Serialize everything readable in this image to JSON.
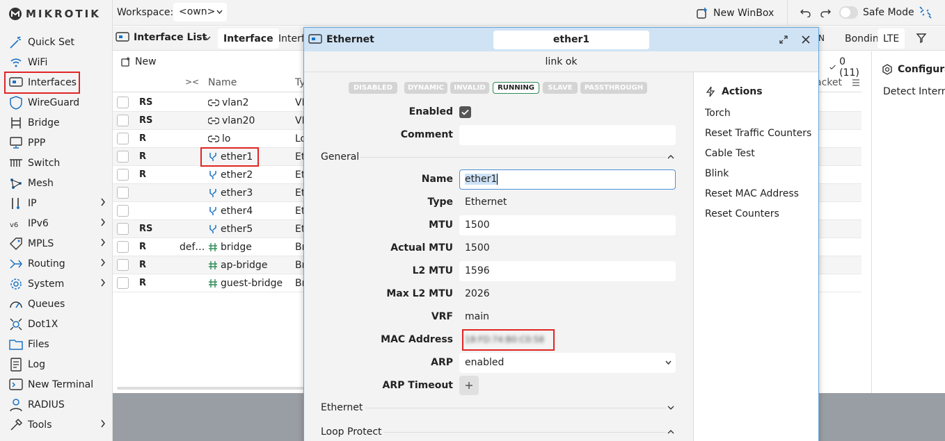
{
  "app": {
    "logo_text": "MIKROTIK"
  },
  "sidebar": {
    "items": [
      {
        "label": "Quick Set",
        "icon": "wand-icon",
        "chevron": false
      },
      {
        "label": "WiFi",
        "icon": "wifi-icon",
        "chevron": false
      },
      {
        "label": "Interfaces",
        "icon": "interfaces-icon",
        "chevron": false,
        "highlighted": true
      },
      {
        "label": "WireGuard",
        "icon": "shield-icon",
        "chevron": false
      },
      {
        "label": "Bridge",
        "icon": "bridge-icon",
        "chevron": false
      },
      {
        "label": "PPP",
        "icon": "ppp-icon",
        "chevron": false
      },
      {
        "label": "Switch",
        "icon": "switch-icon",
        "chevron": false
      },
      {
        "label": "Mesh",
        "icon": "mesh-icon",
        "chevron": false
      },
      {
        "label": "IP",
        "icon": "ip-icon",
        "chevron": true
      },
      {
        "label": "IPv6",
        "icon": "ipv6-icon",
        "chevron": true
      },
      {
        "label": "MPLS",
        "icon": "tag-icon",
        "chevron": true
      },
      {
        "label": "Routing",
        "icon": "routing-icon",
        "chevron": true
      },
      {
        "label": "System",
        "icon": "gear-icon",
        "chevron": true
      },
      {
        "label": "Queues",
        "icon": "gauge-icon",
        "chevron": false
      },
      {
        "label": "Dot1X",
        "icon": "dot1x-icon",
        "chevron": false
      },
      {
        "label": "Files",
        "icon": "folder-icon",
        "chevron": false
      },
      {
        "label": "Log",
        "icon": "log-icon",
        "chevron": false
      },
      {
        "label": "New Terminal",
        "icon": "terminal-icon",
        "chevron": false
      },
      {
        "label": "RADIUS",
        "icon": "radius-icon",
        "chevron": false
      },
      {
        "label": "Tools",
        "icon": "tools-icon",
        "chevron": true
      }
    ]
  },
  "topbar": {
    "workspace_label": "Workspace:",
    "workspace_value": "<own>",
    "new_winbox": "New WinBox",
    "safe_mode": "Safe Mode"
  },
  "tabbar": {
    "title": "Interface List",
    "tab_active": "Interface",
    "tab_partial": "Interf",
    "right_tabs": [
      "Bonding",
      "LTE"
    ]
  },
  "list": {
    "new_button": "New",
    "count": "0 (11)",
    "columns": {
      "name": "Name",
      "type_partial": "Ty",
      "packet_partial": "acket"
    },
    "rows": [
      {
        "flags": "RS",
        "comment": "",
        "name": "vlan2",
        "icon": "vlan",
        "type": "VL"
      },
      {
        "flags": "RS",
        "comment": "",
        "name": "vlan20",
        "icon": "vlan",
        "type": "VL"
      },
      {
        "flags": "R",
        "comment": "",
        "name": "lo",
        "icon": "vlan",
        "type": "Lo"
      },
      {
        "flags": "R",
        "comment": "",
        "name": "ether1",
        "icon": "ether",
        "type": "Et"
      },
      {
        "flags": "R",
        "comment": "",
        "name": "ether2",
        "icon": "ether",
        "type": "Et"
      },
      {
        "flags": "",
        "comment": "",
        "name": "ether3",
        "icon": "ether",
        "type": "Et"
      },
      {
        "flags": "",
        "comment": "",
        "name": "ether4",
        "icon": "ether",
        "type": "Et"
      },
      {
        "flags": "RS",
        "comment": "",
        "name": "ether5",
        "icon": "ether",
        "type": "Et"
      },
      {
        "flags": "R",
        "comment": "def…",
        "name": "bridge",
        "icon": "bridge",
        "type": "Br"
      },
      {
        "flags": "R",
        "comment": "",
        "name": "ap-bridge",
        "icon": "bridge",
        "type": "Br"
      },
      {
        "flags": "R",
        "comment": "",
        "name": "guest-bridge",
        "icon": "bridge",
        "type": "Br"
      }
    ]
  },
  "config_panel": {
    "title": "Configura",
    "item": "Detect Interne"
  },
  "dialog": {
    "title": "Ethernet",
    "name_tab": "ether1",
    "status": "link ok",
    "pills": [
      "DISABLED",
      "DYNAMIC",
      "INVALID",
      "RUNNING",
      "SLAVE",
      "PASSTHROUGH"
    ],
    "enabled_label": "Enabled",
    "comment_label": "Comment",
    "comment_value": "",
    "section_general": "General",
    "fields": {
      "name_label": "Name",
      "name_value": "ether1",
      "type_label": "Type",
      "type_value": "Ethernet",
      "mtu_label": "MTU",
      "mtu_value": "1500",
      "actual_mtu_label": "Actual MTU",
      "actual_mtu_value": "1500",
      "l2mtu_label": "L2 MTU",
      "l2mtu_value": "1596",
      "max_l2mtu_label": "Max L2 MTU",
      "max_l2mtu_value": "2026",
      "vrf_label": "VRF",
      "vrf_value": "main",
      "mac_label": "MAC Address",
      "mac_value": "18:FD:74:B0:C0:58",
      "arp_label": "ARP",
      "arp_value": "enabled",
      "arp_timeout_label": "ARP Timeout"
    },
    "section_ethernet": "Ethernet",
    "section_loop": "Loop Protect",
    "actions_title": "Actions",
    "actions": [
      "Torch",
      "Reset Traffic Counters",
      "Cable Test",
      "Blink",
      "Reset MAC Address",
      "Reset Counters"
    ]
  }
}
